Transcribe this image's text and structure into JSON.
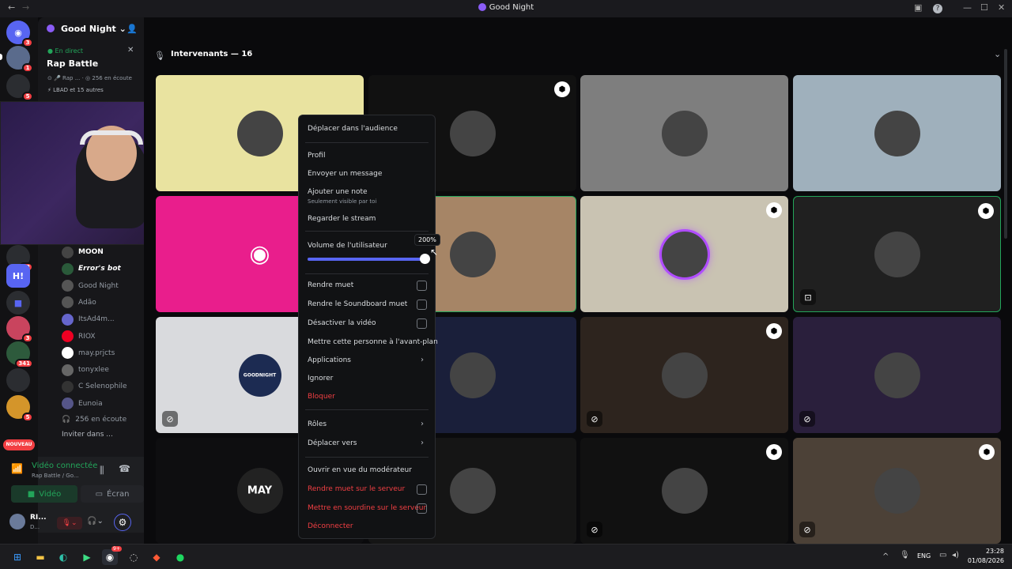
{
  "window": {
    "title": "Good Night"
  },
  "server": {
    "name": "Good Night"
  },
  "rail": {
    "badges": [
      "3",
      "1",
      "5",
      "22",
      "3",
      "341",
      "5"
    ],
    "new_label": "NOUVEAU",
    "h_logo": "H!"
  },
  "live": {
    "status": "En direct",
    "stage_title": "Rap Battle",
    "meta": "Rap ...",
    "listening": "256 en écoute",
    "users": "LBAD et 15 autres"
  },
  "members": [
    {
      "name": "MOON"
    },
    {
      "name": "Error's bot"
    },
    {
      "name": "Good Night"
    },
    {
      "name": "Adão"
    },
    {
      "name": "ItsAd4m..."
    },
    {
      "name": "RIOX"
    },
    {
      "name": "may.prjcts"
    },
    {
      "name": "tonyxlee"
    },
    {
      "name": "C Selenophile"
    },
    {
      "name": "Eunoia"
    }
  ],
  "listening_count": "256 en écoute",
  "invite_label": "Inviter dans ...",
  "voice": {
    "status": "Vidéo connectée",
    "sub": "Rap Battle / Go...",
    "video_btn": "Vidéo",
    "screen_btn": "Écran"
  },
  "user": {
    "name": "RI...",
    "status": "D..."
  },
  "stage_header": {
    "title": "Intervenants — 16"
  },
  "tiles": [
    {
      "label": "",
      "color": "#e9e3a0"
    },
    {
      "label": "",
      "color": "#111111"
    },
    {
      "label": "",
      "color": "#7e7e7e"
    },
    {
      "label": "",
      "color": "#9fb0bc"
    },
    {
      "label": "",
      "color": "#e91e8c"
    },
    {
      "label": "",
      "color": "#a68566"
    },
    {
      "label": "",
      "color": "#c9c3b2"
    },
    {
      "label": "",
      "color": "#202020"
    },
    {
      "label": "GOODNIGHT",
      "color": "#d9dadd"
    },
    {
      "label": "",
      "color": "#1a1f3a"
    },
    {
      "label": "",
      "color": "#2d241e"
    },
    {
      "label": "",
      "color": "#2a1f3c"
    },
    {
      "label": "MAY",
      "color": "#0e0e10"
    },
    {
      "label": "",
      "color": "#151515"
    },
    {
      "label": "",
      "color": "#111111"
    },
    {
      "label": "",
      "color": "#4c4137"
    }
  ],
  "context_menu": {
    "move_audience": "Déplacer dans l'audience",
    "profile": "Profil",
    "send_message": "Envoyer un message",
    "add_note": "Ajouter une note",
    "note_hint": "Seulement visible par toi",
    "watch_stream": "Regarder le stream",
    "volume_label": "Volume de l'utilisateur",
    "volume_value": "200%",
    "volume_fraction": 1.0,
    "mute": "Rendre muet",
    "mute_soundboard": "Rendre le Soundboard muet",
    "disable_video": "Désactiver la vidéo",
    "spotlight": "Mettre cette personne à l'avant-plan",
    "apps": "Applications",
    "ignore": "Ignorer",
    "block": "Bloquer",
    "roles": "Rôles",
    "move_to": "Déplacer vers",
    "mod_view": "Ouvrir en vue du modérateur",
    "server_mute": "Rendre muet sur le serveur",
    "server_deafen": "Mettre en sourdine sur le serveur",
    "disconnect": "Déconnecter"
  },
  "taskbar": {
    "lang": "ENG",
    "time": "23:28",
    "date": "01/08/2026",
    "discord_badge": "9+"
  },
  "colors": {
    "accent": "#5865f2",
    "danger": "#f23f43",
    "green": "#23a55a"
  }
}
